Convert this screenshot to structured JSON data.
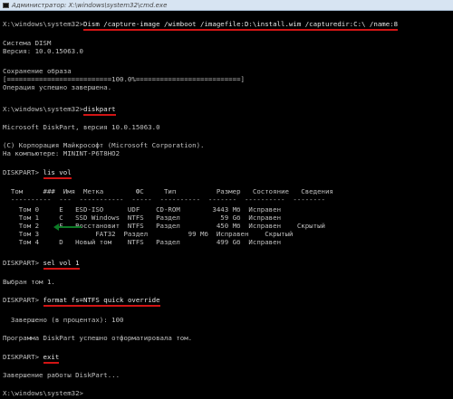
{
  "window": {
    "title": "Администратор: X:\\windows\\system32\\cmd.exe"
  },
  "console": {
    "dism_prompt": "X:\\windows\\system32>",
    "dism_command": "Dism /capture-image /wimboot /imagefile:D:\\install.wim /capturedir:C:\\ /name:8",
    "dism_system": "Система DISM",
    "dism_version": "Версия: 10.0.15063.0",
    "saving_image": "Сохранение образа",
    "progress_bar": "[==========================100.0%==========================]",
    "op_success": "Операция успешно завершена.",
    "diskpart_prompt": "X:\\windows\\system32>",
    "diskpart_command": "diskpart",
    "diskpart_version": "Microsoft DiskPart, версия 10.0.15063.0",
    "copyright": "(C) Корпорация Майкрософт (Microsoft Corporation).",
    "computer": "На компьютере: MININT-P6T8HO2",
    "lis_prompt": "DISKPART> ",
    "lis_command": "lis vol",
    "volume_header": "  Том     ###  Имя  Метка        ФС     Тип          Размер   Состояние   Сведения",
    "volume_separator": "  ----------  ---  -----------  -----  ----------  -------  ----------  --------",
    "volume_rows": [
      "    Том 0     E   ESD-ISO      UDF    CD-ROM        3443 Mб  Исправен",
      "    Том 1     C   SSD Windows  NTFS   Раздел          59 Gб  Исправен",
      "    Том 2     F   Восстановит  NTFS   Раздел         450 Mб  Исправен    Скрытый",
      "    Том 3              FAT32  Раздел          99 Mб  Исправен    Скрытый",
      "    Том 4     D   Новый том    NTFS   Раздел         499 Gб  Исправен"
    ],
    "sel_prompt": "DISKPART> ",
    "sel_command": "sel vol 1",
    "sel_result": "Выбран том 1.",
    "format_prompt": "DISKPART> ",
    "format_command": "format fs=NTFS quick override",
    "format_percent": "  Завершено (в процентах): 100",
    "format_result": "Программа DiskPart успешно отформатировала том.",
    "exit_prompt": "DISKPART> ",
    "exit_command": "exit",
    "exit_result": "Завершение работы DiskPart...",
    "final_prompt": "X:\\windows\\system32>"
  }
}
